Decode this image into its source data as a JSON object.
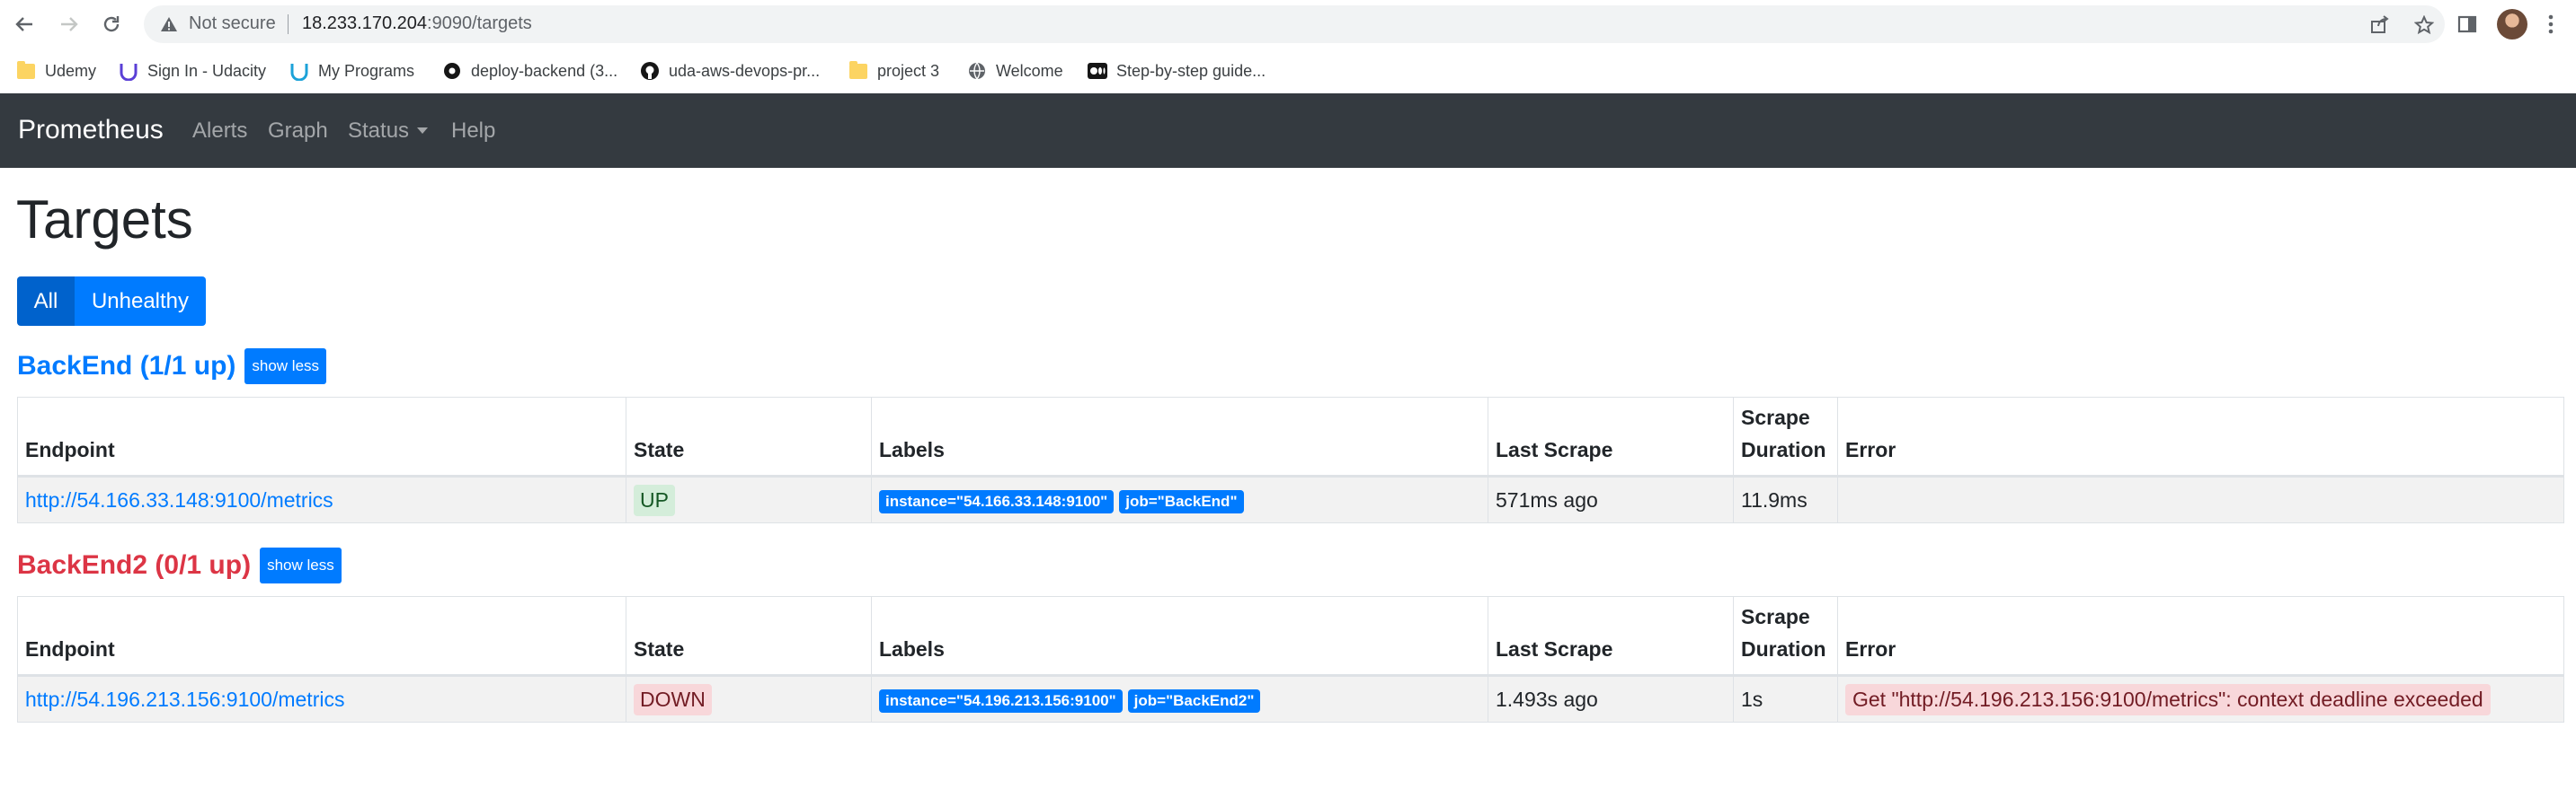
{
  "browser": {
    "omnibox": {
      "security_label": "Not secure",
      "url_host": "18.233.170.204",
      "url_rest": ":9090/targets"
    },
    "bookmarks": [
      {
        "label": "Udemy",
        "icon": "folder-icon"
      },
      {
        "label": "Sign In - Udacity",
        "icon": "udacity-icon"
      },
      {
        "label": "My Programs",
        "icon": "udacity-icon"
      },
      {
        "label": "deploy-backend (3...",
        "icon": "circleci-icon"
      },
      {
        "label": "uda-aws-devops-pr...",
        "icon": "github-icon"
      },
      {
        "label": "project 3",
        "icon": "folder-icon"
      },
      {
        "label": "Welcome",
        "icon": "globe-icon"
      },
      {
        "label": "Step-by-step guide...",
        "icon": "medium-icon"
      }
    ]
  },
  "navbar": {
    "brand": "Prometheus",
    "links": {
      "alerts": "Alerts",
      "graph": "Graph",
      "status": "Status",
      "help": "Help"
    }
  },
  "page": {
    "title": "Targets",
    "filters": {
      "all": "All",
      "unhealthy": "Unhealthy"
    }
  },
  "columns": {
    "endpoint": "Endpoint",
    "state": "State",
    "labels": "Labels",
    "last_scrape": "Last Scrape",
    "scrape_duration_1": "Scrape",
    "scrape_duration_2": "Duration",
    "error": "Error"
  },
  "pools": [
    {
      "name": "BackEnd (1/1 up)",
      "status": "healthy",
      "toggle": "show less",
      "targets": [
        {
          "endpoint": "http://54.166.33.148:9100/metrics",
          "state": "UP",
          "labels": [
            "instance=\"54.166.33.148:9100\"",
            "job=\"BackEnd\""
          ],
          "last_scrape": "571ms ago",
          "scrape_duration": "11.9ms",
          "error": ""
        }
      ]
    },
    {
      "name": "BackEnd2 (0/1 up)",
      "status": "unhealthy",
      "toggle": "show less",
      "targets": [
        {
          "endpoint": "http://54.196.213.156:9100/metrics",
          "state": "DOWN",
          "labels": [
            "instance=\"54.196.213.156:9100\"",
            "job=\"BackEnd2\""
          ],
          "last_scrape": "1.493s ago",
          "scrape_duration": "1s",
          "error": "Get \"http://54.196.213.156:9100/metrics\": context deadline exceeded"
        }
      ]
    }
  ],
  "colors": {
    "navbar_bg": "#343a40",
    "primary": "#007bff",
    "danger": "#dc3545",
    "up_badge_bg": "#d4edda",
    "down_badge_bg": "#f8d7da"
  }
}
